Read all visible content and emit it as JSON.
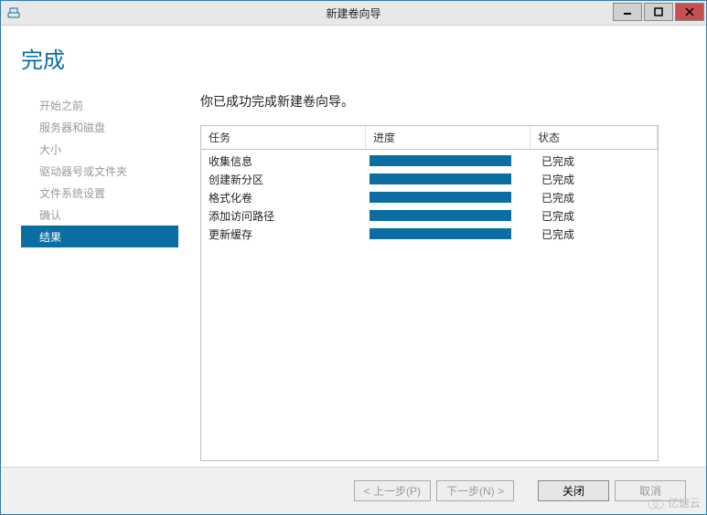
{
  "window": {
    "title": "新建卷向导"
  },
  "page": {
    "heading": "完成"
  },
  "sidebar": {
    "items": [
      {
        "label": "开始之前"
      },
      {
        "label": "服务器和磁盘"
      },
      {
        "label": "大小"
      },
      {
        "label": "驱动器号或文件夹"
      },
      {
        "label": "文件系统设置"
      },
      {
        "label": "确认"
      },
      {
        "label": "结果"
      }
    ],
    "active_index": 6
  },
  "main": {
    "subtitle": "你已成功完成新建卷向导。",
    "columns": {
      "task": "任务",
      "progress": "进度",
      "status": "状态"
    },
    "rows": [
      {
        "task": "收集信息",
        "status": "已完成"
      },
      {
        "task": "创建新分区",
        "status": "已完成"
      },
      {
        "task": "格式化卷",
        "status": "已完成"
      },
      {
        "task": "添加访问路径",
        "status": "已完成"
      },
      {
        "task": "更新缓存",
        "status": "已完成"
      }
    ]
  },
  "buttons": {
    "prev": "< 上一步(P)",
    "next": "下一步(N) >",
    "close": "关闭",
    "cancel": "取消"
  },
  "watermark": "亿速云"
}
